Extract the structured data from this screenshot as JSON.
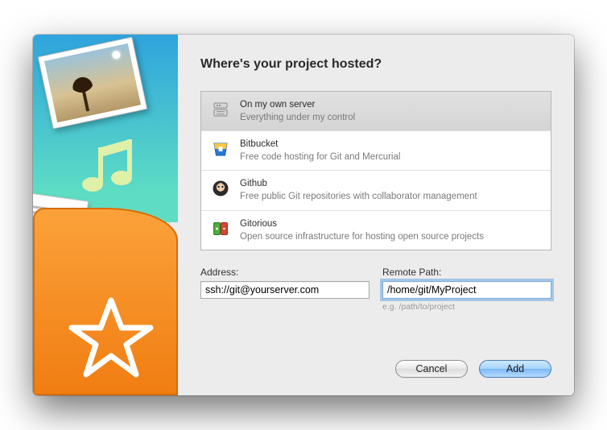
{
  "header": {
    "title": "Where's your project hosted?"
  },
  "hosts": [
    {
      "title": "On my own server",
      "subtitle": "Everything under my control",
      "icon": "server-icon",
      "selected": true
    },
    {
      "title": "Bitbucket",
      "subtitle": "Free code hosting for Git and Mercurial",
      "icon": "bitbucket-icon",
      "selected": false
    },
    {
      "title": "Github",
      "subtitle": "Free public Git repositories with collaborator management",
      "icon": "github-icon",
      "selected": false
    },
    {
      "title": "Gitorious",
      "subtitle": "Open source infrastructure for hosting open source projects",
      "icon": "gitorious-icon",
      "selected": false
    }
  ],
  "form": {
    "address_label": "Address:",
    "address_value": "ssh://git@yourserver.com",
    "path_label": "Remote Path:",
    "path_value": "/home/git/MyProject",
    "path_hint": "e.g. /path/to/project"
  },
  "buttons": {
    "cancel": "Cancel",
    "add": "Add"
  }
}
